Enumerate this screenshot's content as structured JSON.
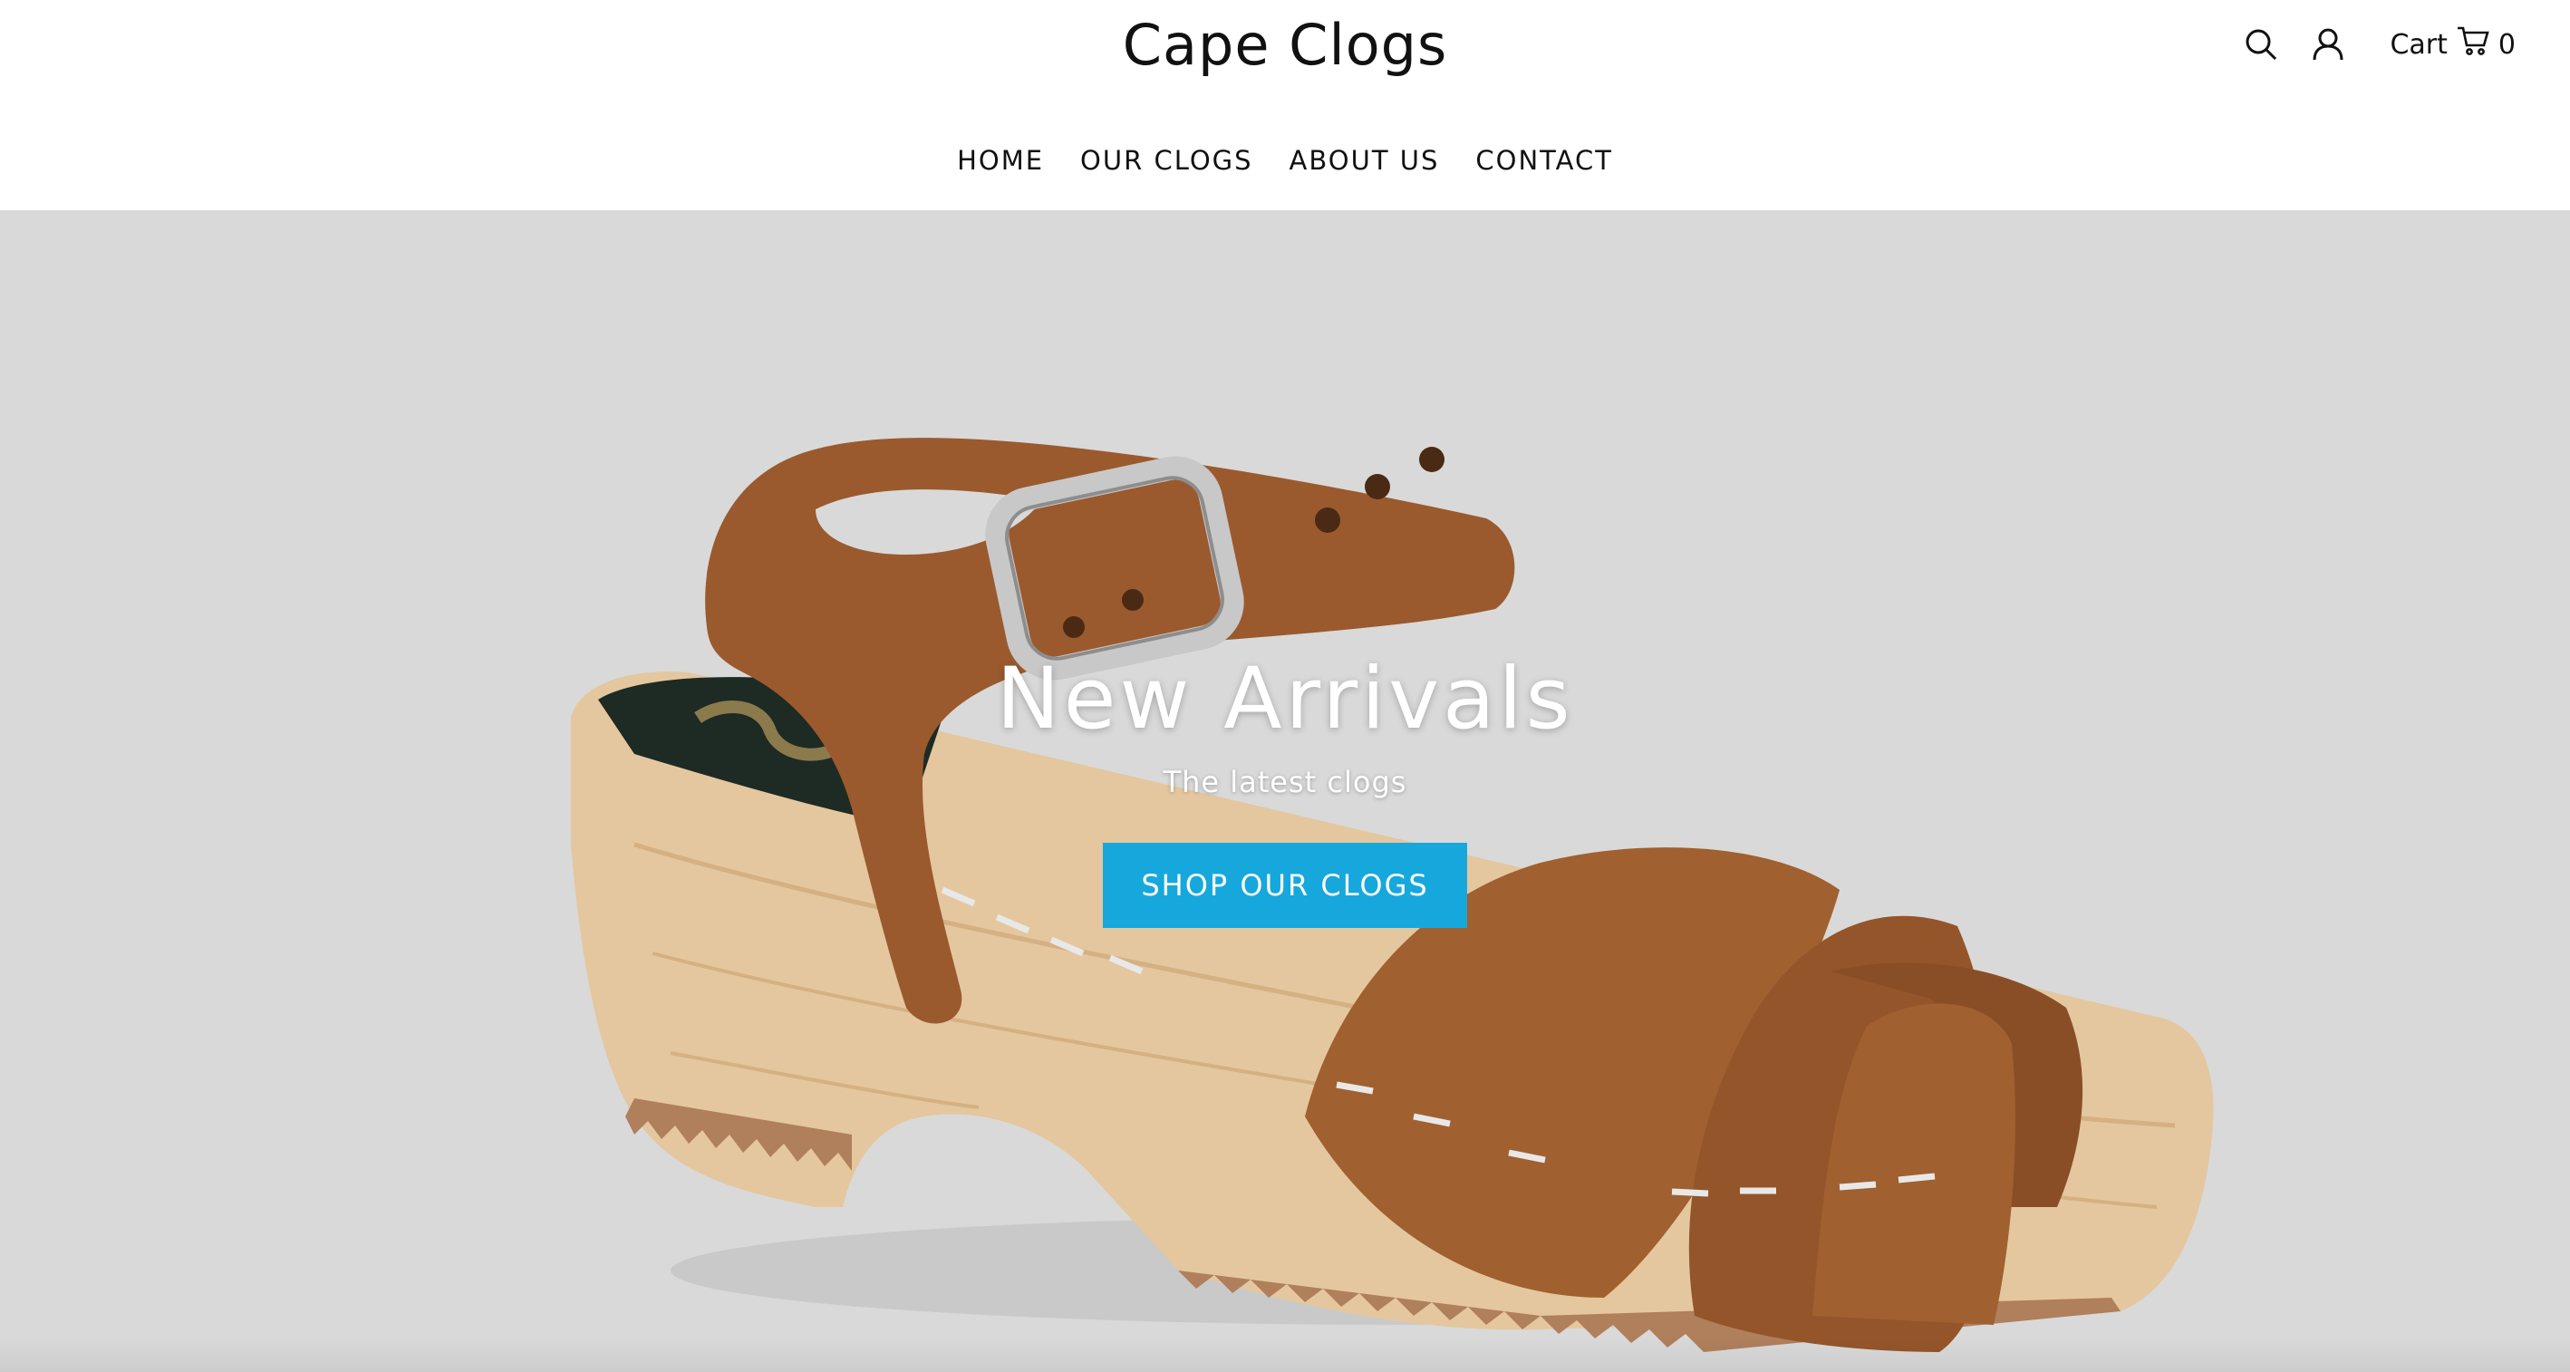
{
  "header": {
    "logo": "Cape Clogs",
    "cart_label": "Cart",
    "cart_count": "0",
    "icons": [
      "search-icon",
      "account-icon",
      "cart-icon"
    ]
  },
  "nav": {
    "items": [
      {
        "label": "HOME"
      },
      {
        "label": "OUR CLOGS"
      },
      {
        "label": "ABOUT US"
      },
      {
        "label": "CONTACT"
      }
    ]
  },
  "hero": {
    "title": "New Arrivals",
    "subtitle": "The latest clogs",
    "button_label": "SHOP OUR CLOGS",
    "image_subject": "brown leather sandal clog with wooden sole"
  },
  "colors": {
    "accent": "#16a8dc",
    "hero_background": "#d9d9d9",
    "leather": "#9a5a2e",
    "wood": "#e4c79e"
  }
}
